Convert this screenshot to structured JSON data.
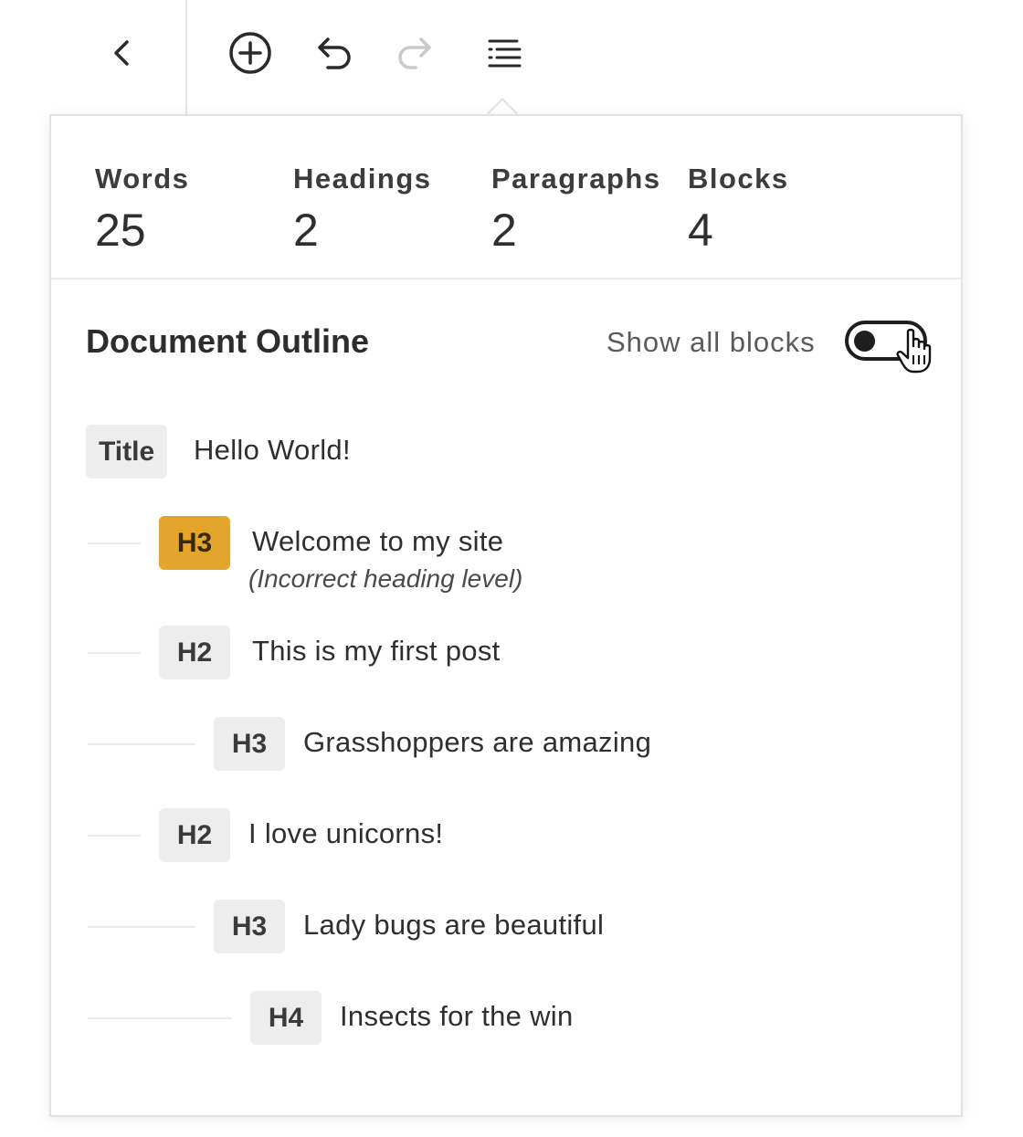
{
  "toolbar": {
    "back_icon": "chevron-left-icon",
    "add_icon": "plus-circle-icon",
    "undo_icon": "undo-icon",
    "redo_icon": "redo-icon",
    "outline_icon": "list-view-icon"
  },
  "stats": [
    {
      "label": "Words",
      "value": "25"
    },
    {
      "label": "Headings",
      "value": "2"
    },
    {
      "label": "Paragraphs",
      "value": "2"
    },
    {
      "label": "Blocks",
      "value": "4"
    }
  ],
  "outline": {
    "title": "Document Outline",
    "show_all_label": "Show all blocks",
    "show_all_enabled": false,
    "items": [
      {
        "level": "Title",
        "text": "Hello World!",
        "note": ""
      },
      {
        "level": "H3",
        "text": "Welcome to my site",
        "note": "(Incorrect heading level)",
        "warning": true
      },
      {
        "level": "H2",
        "text": "This is my first post",
        "note": ""
      },
      {
        "level": "H3",
        "text": "Grasshoppers are amazing",
        "note": ""
      },
      {
        "level": "H2",
        "text": "I love unicorns!",
        "note": ""
      },
      {
        "level": "H3",
        "text": "Lady bugs are beautiful",
        "note": ""
      },
      {
        "level": "H4",
        "text": "Insects for the win",
        "note": ""
      }
    ]
  },
  "colors": {
    "warning": "#e3a52b",
    "badge": "#ededed",
    "text": "#1e1e1e"
  }
}
